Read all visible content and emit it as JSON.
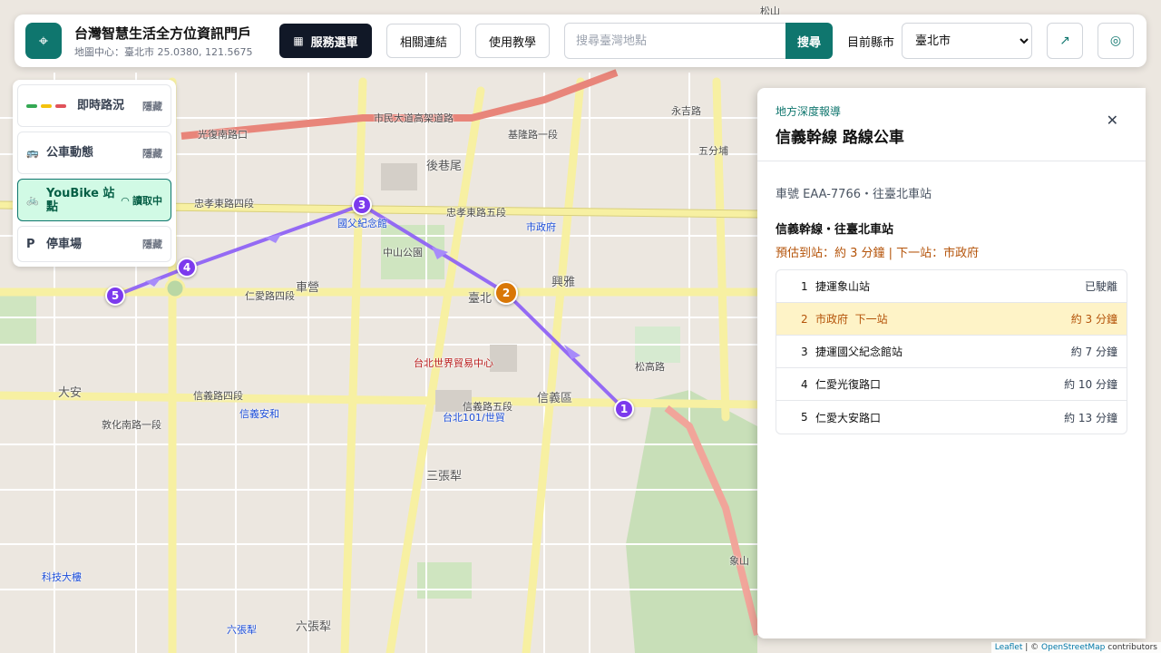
{
  "header": {
    "title": "台灣智慧生活全方位資訊門戶",
    "subtitle": "地圖中心：臺北市 25.0380, 121.5675",
    "service_menu": "服務選單",
    "links": "相關連結",
    "tutorial": "使用教學",
    "search_placeholder": "搜尋臺灣地點",
    "search_button": "搜尋",
    "county_label": "目前縣市",
    "county_selected": "臺北市"
  },
  "layers": [
    {
      "name": "即時路況",
      "status": "隱藏"
    },
    {
      "name": "公車動態",
      "status": "隱藏"
    },
    {
      "name": "YouBike 站點",
      "status": "讀取中"
    },
    {
      "name": "停車場",
      "status": "隱藏"
    }
  ],
  "panel": {
    "kicker": "地方深度報導",
    "title": "信義幹線 路線公車",
    "vehicle": "車號 EAA-7766・往臺北車站",
    "route": "信義幹線・往臺北車站",
    "eta": "預估到站：約 3 分鐘 | 下一站：市政府",
    "stops": [
      {
        "no": "1",
        "name": "捷運象山站",
        "status": "已駛離"
      },
      {
        "no": "2",
        "name": "市政府  下一站",
        "status": "約 3 分鐘"
      },
      {
        "no": "3",
        "name": "捷運國父紀念館站",
        "status": "約 7 分鐘"
      },
      {
        "no": "4",
        "name": "仁愛光復路口",
        "status": "約 10 分鐘"
      },
      {
        "no": "5",
        "name": "仁愛大安路口",
        "status": "約 13 分鐘"
      }
    ]
  },
  "map": {
    "markers": [
      "1",
      "2",
      "3",
      "4",
      "5"
    ],
    "labels": {
      "l1": "光復南路口",
      "l2": "市民大道高架道路",
      "l3": "忠孝東路四段",
      "l4": "忠孝東路五段",
      "l5": "仁愛路四段",
      "l6": "信義路四段",
      "l7": "信義路五段",
      "l8": "後巷尾",
      "l9": "車營",
      "l10": "臺北",
      "l11": "信義區",
      "l12": "三張犁",
      "l13": "六張犁",
      "l14": "大安",
      "l15": "象山",
      "l16": "中山公園",
      "l17": "市政府",
      "l18": "國父紀念館",
      "l19": "台北101/世貿",
      "l20": "松山",
      "l21": "永吉路",
      "l22": "信義安和",
      "l23": "科技大樓",
      "l24": "六張犁",
      "l25": "基隆路一段",
      "l26": "松高路",
      "l27": "興雅",
      "l28": "台北世界貿易中心",
      "l29": "五分埔",
      "l30": "敦化南路一段"
    },
    "attribution_leaflet": "Leaflet",
    "attribution_sep": " | © ",
    "attribution_osm": "OpenStreetMap",
    "attribution_tail": " contributors"
  }
}
